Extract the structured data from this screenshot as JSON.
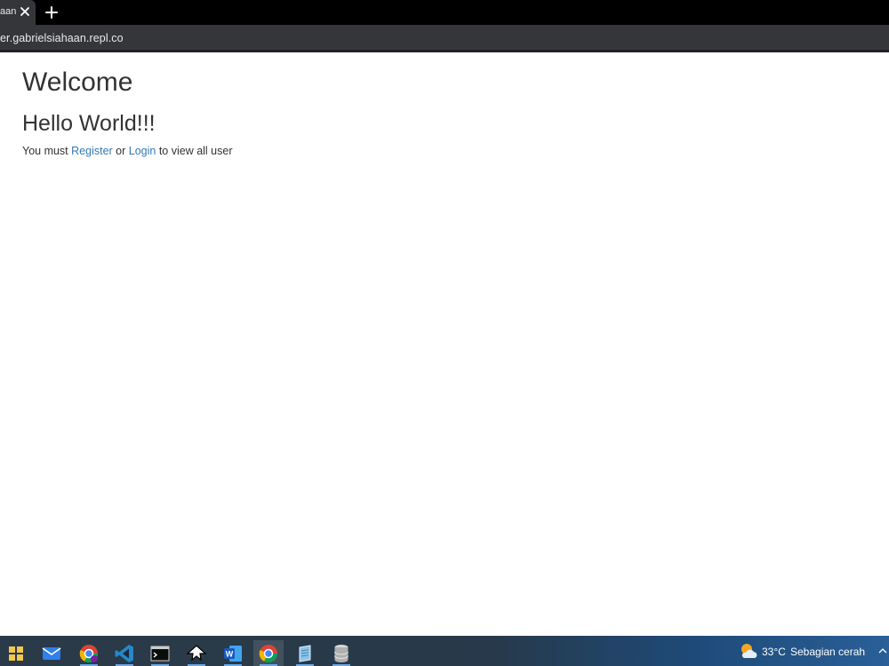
{
  "browser": {
    "tab": {
      "title": "aan"
    },
    "address_bar": {
      "url": "er.gabrielsiahaan.repl.co"
    }
  },
  "page": {
    "heading": "Welcome",
    "subheading": "Hello World!!!",
    "message": {
      "prefix": "You must ",
      "register_link": "Register",
      "middle": " or ",
      "login_link": "Login",
      "suffix": " to view all user"
    }
  },
  "taskbar": {
    "icons": [
      "start-icon",
      "mail-icon",
      "chrome-profile-icon",
      "vscode-icon",
      "terminal-icon",
      "inkscape-icon",
      "word-icon",
      "chrome-icon",
      "notepad-icon",
      "database-icon"
    ],
    "weather": {
      "temperature": "33°C",
      "condition": "Sebagian cerah"
    }
  },
  "colors": {
    "link": "#337ab7",
    "text": "#333333",
    "chrome_dark": "#35363a"
  }
}
